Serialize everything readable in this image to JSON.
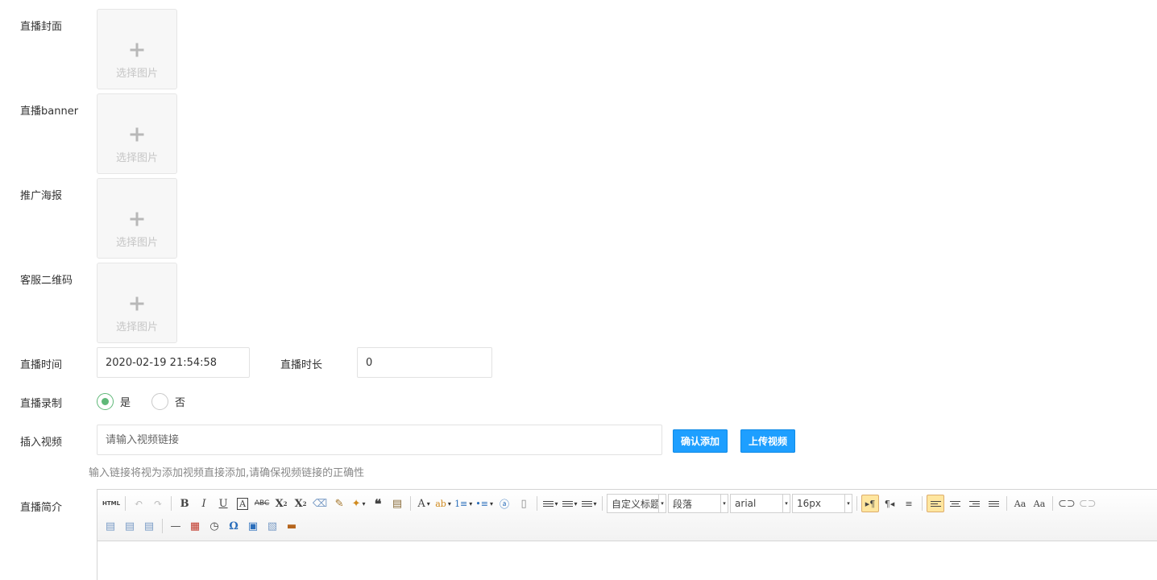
{
  "form": {
    "cover_label": "直播封面",
    "banner_label": "直播banner",
    "poster_label": "推广海报",
    "qrcode_label": "客服二维码",
    "upload_text": "选择图片",
    "time_label": "直播时间",
    "time_value": "2020-02-19 21:54:58",
    "duration_label": "直播时长",
    "duration_value": "0",
    "record_label": "直播录制",
    "record_yes": "是",
    "record_no": "否",
    "video_label": "插入视频",
    "video_placeholder": "请输入视频链接",
    "confirm_add": "确认添加",
    "upload_video": "上传视频",
    "video_hint": "输入链接将视为添加视频直接添加,请确保视频链接的正确性",
    "intro_label": "直播简介"
  },
  "editor": {
    "html_btn": "HTML",
    "heading_combo": "自定义标题",
    "paragraph_combo": "段落",
    "font_combo": "arial",
    "size_combo": "16px"
  },
  "colors": {
    "accent": "#1e9fff",
    "radio_checked": "#5fb878"
  }
}
